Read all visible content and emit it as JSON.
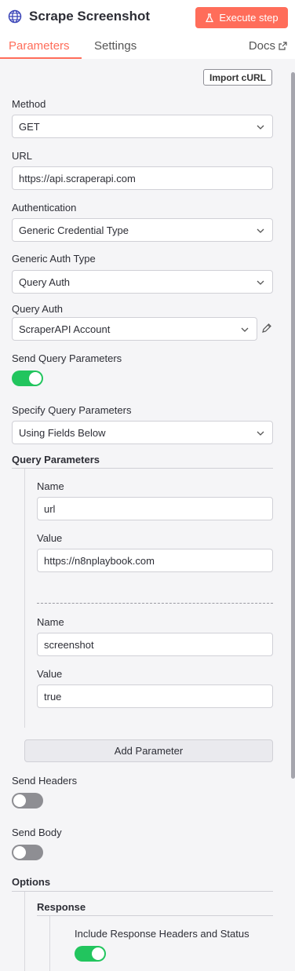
{
  "header": {
    "title": "Scrape Screenshot",
    "execute_label": "Execute step",
    "icon": "globe-icon"
  },
  "tabs": [
    {
      "label": "Parameters",
      "active": true
    },
    {
      "label": "Settings",
      "active": false
    }
  ],
  "docs_label": "Docs",
  "import_label": "Import cURL",
  "method": {
    "label": "Method",
    "value": "GET"
  },
  "url": {
    "label": "URL",
    "value": "https://api.scraperapi.com"
  },
  "authentication": {
    "label": "Authentication",
    "value": "Generic Credential Type"
  },
  "generic_auth_type": {
    "label": "Generic Auth Type",
    "value": "Query Auth"
  },
  "query_auth": {
    "label": "Query Auth",
    "value": "ScraperAPI Account"
  },
  "send_query": {
    "label": "Send Query Parameters",
    "enabled": true
  },
  "specify_query": {
    "label": "Specify Query Parameters",
    "value": "Using Fields Below"
  },
  "query_parameters": {
    "label": "Query Parameters",
    "items": [
      {
        "name_label": "Name",
        "name": "url",
        "value_label": "Value",
        "value": "https://n8nplaybook.com"
      },
      {
        "name_label": "Name",
        "name": "screenshot",
        "value_label": "Value",
        "value": "true"
      }
    ],
    "add_label": "Add Parameter"
  },
  "send_headers": {
    "label": "Send Headers",
    "enabled": false
  },
  "send_body": {
    "label": "Send Body",
    "enabled": false
  },
  "options": {
    "label": "Options",
    "response": {
      "label": "Response",
      "include_headers": {
        "label": "Include Response Headers and Status",
        "enabled": true
      }
    }
  },
  "colors": {
    "accent": "#ff6d5a",
    "toggle_on": "#22c55e",
    "toggle_off": "#8e8e93"
  }
}
